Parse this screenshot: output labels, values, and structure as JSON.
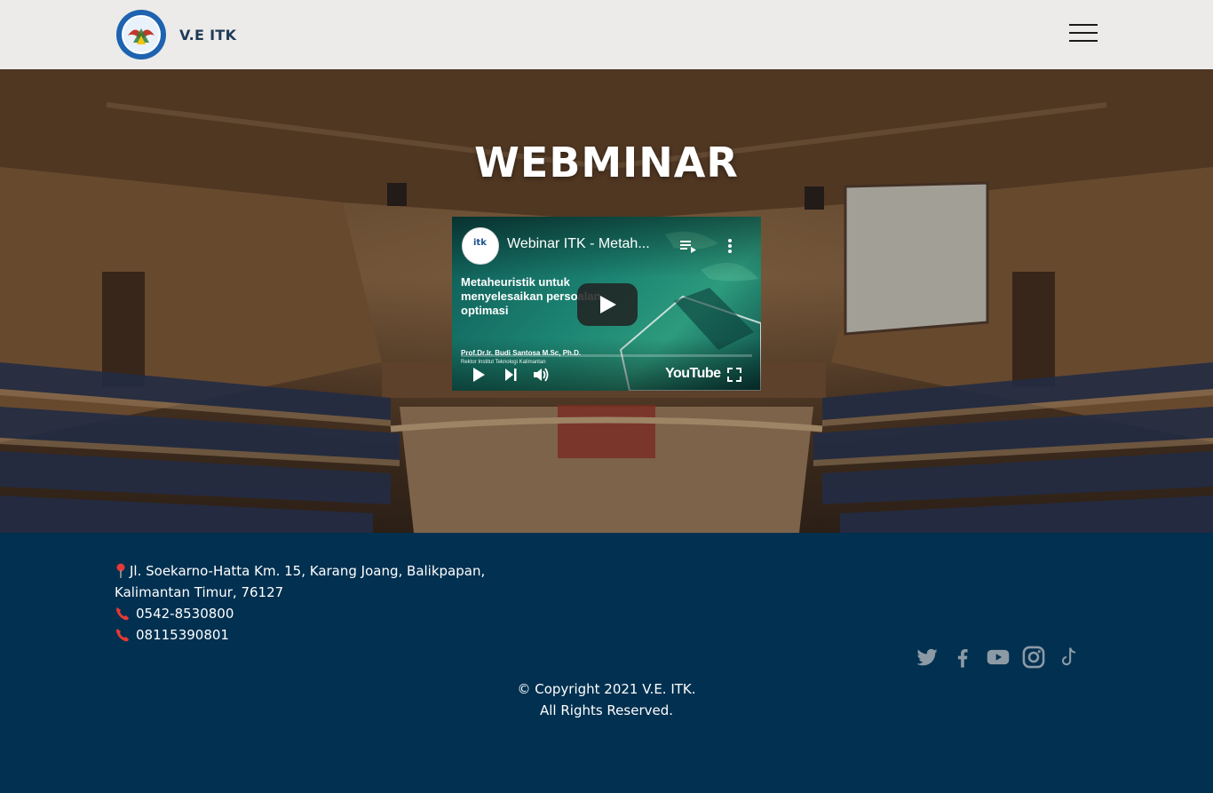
{
  "header": {
    "brand_name": "V.E ITK"
  },
  "hero": {
    "title": "WEBMINAR"
  },
  "video": {
    "title": "Webinar ITK - Metah...",
    "thumbnail_heading": "Metaheuristik untuk menyelesaikan persoalan optimasi",
    "thumbnail_author": "Prof.Dr.Ir. Budi Santosa M.Sc, Ph.D.",
    "thumbnail_role": "Rektor Institut Teknologi Kalimantan",
    "channel_avatar_text": "itk",
    "player_brand": "YouTube"
  },
  "footer": {
    "address_line1": "Jl. Soekarno-Hatta Km. 15, Karang Joang, Balikpapan,",
    "address_line2": "Kalimantan Timur, 76127",
    "phone1": "0542-8530800",
    "phone2": "08115390801",
    "copyright_line1": "© Copyright 2021 V.E. ITK.",
    "copyright_line2": "All Rights Reserved.",
    "social_icons": [
      "twitter-icon",
      "facebook-icon",
      "youtube-icon",
      "instagram-icon",
      "tiktok-icon"
    ]
  },
  "colors": {
    "header_bg": "#ecebe9",
    "brand_text": "#1f3a57",
    "footer_bg": "#013050",
    "social_icon": "#8c9aa6",
    "pin_red": "#e53935"
  }
}
